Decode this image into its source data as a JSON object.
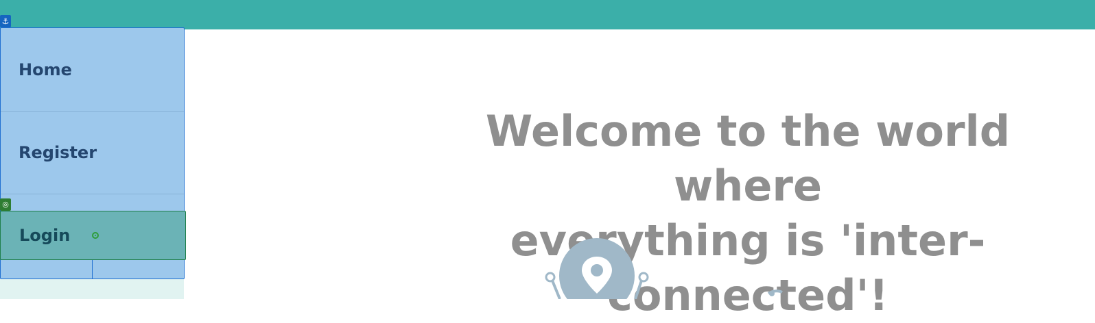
{
  "nav": {
    "items": [
      {
        "label": "Home"
      },
      {
        "label": "Register"
      },
      {
        "label": "Login"
      }
    ],
    "active": "Login"
  },
  "hero": {
    "line1": "Welcome to the world where",
    "line2": "everything is 'inter-connected'!"
  },
  "colors": {
    "topbar": "#3bafa9",
    "sidebar": "#9dc8ec",
    "active_item": "#6bb3b6",
    "nav_text": "#24466f",
    "headline": "#8f8f8f",
    "logo": "#a0b8c8"
  },
  "icons": {
    "anchor_badge": "anchor-icon",
    "target_badge": "target-icon",
    "crosshair": "crosshair-icon",
    "logo": "location-pin-icon"
  }
}
